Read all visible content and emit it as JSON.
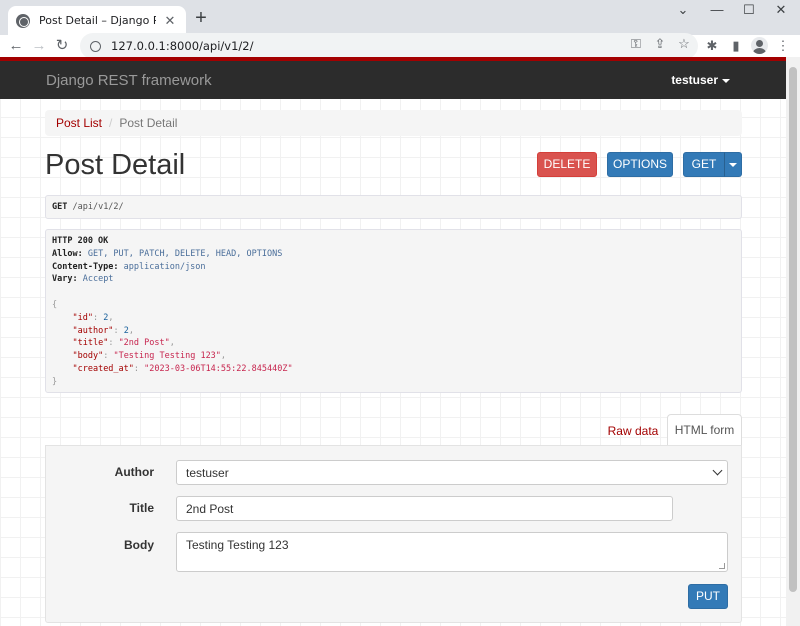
{
  "browser": {
    "tab_title": "Post Detail – Django REST framework",
    "tab_close": "✕",
    "new_tab": "+",
    "url": "127.0.0.1:8000/api/v1/2/",
    "window_controls": [
      "⌄",
      "—",
      "☐",
      "✕"
    ]
  },
  "navbar": {
    "brand": "Django REST framework",
    "user": "testuser"
  },
  "breadcrumb": {
    "link": "Post List",
    "separator": "/",
    "active": "Post Detail"
  },
  "page_title": "Post Detail",
  "buttons": {
    "delete": "DELETE",
    "options": "OPTIONS",
    "get": "GET"
  },
  "request": {
    "method": "GET",
    "path": "/api/v1/2/"
  },
  "response": {
    "status": "HTTP 200 OK",
    "headers": [
      {
        "name": "Allow:",
        "value": "GET, PUT, PATCH, DELETE, HEAD, OPTIONS"
      },
      {
        "name": "Content-Type:",
        "value": "application/json"
      },
      {
        "name": "Vary:",
        "value": "Accept"
      }
    ],
    "open_brace": "{",
    "close_brace": "}",
    "fields": [
      {
        "key": "\"id\"",
        "value": "2",
        "type": "num",
        "comma": ","
      },
      {
        "key": "\"author\"",
        "value": "2",
        "type": "num",
        "comma": ","
      },
      {
        "key": "\"title\"",
        "value": "\"2nd Post\"",
        "type": "str",
        "comma": ","
      },
      {
        "key": "\"body\"",
        "value": "\"Testing Testing 123\"",
        "type": "str",
        "comma": ","
      },
      {
        "key": "\"created_at\"",
        "value": "\"2023-03-06T14:55:22.845440Z\"",
        "type": "str",
        "comma": ""
      }
    ]
  },
  "form_tabs": {
    "raw": "Raw data",
    "html": "HTML form"
  },
  "form": {
    "author_label": "Author",
    "author_value": "testuser",
    "title_label": "Title",
    "title_value": "2nd Post",
    "body_label": "Body",
    "body_value": "Testing Testing 123",
    "submit": "PUT"
  }
}
